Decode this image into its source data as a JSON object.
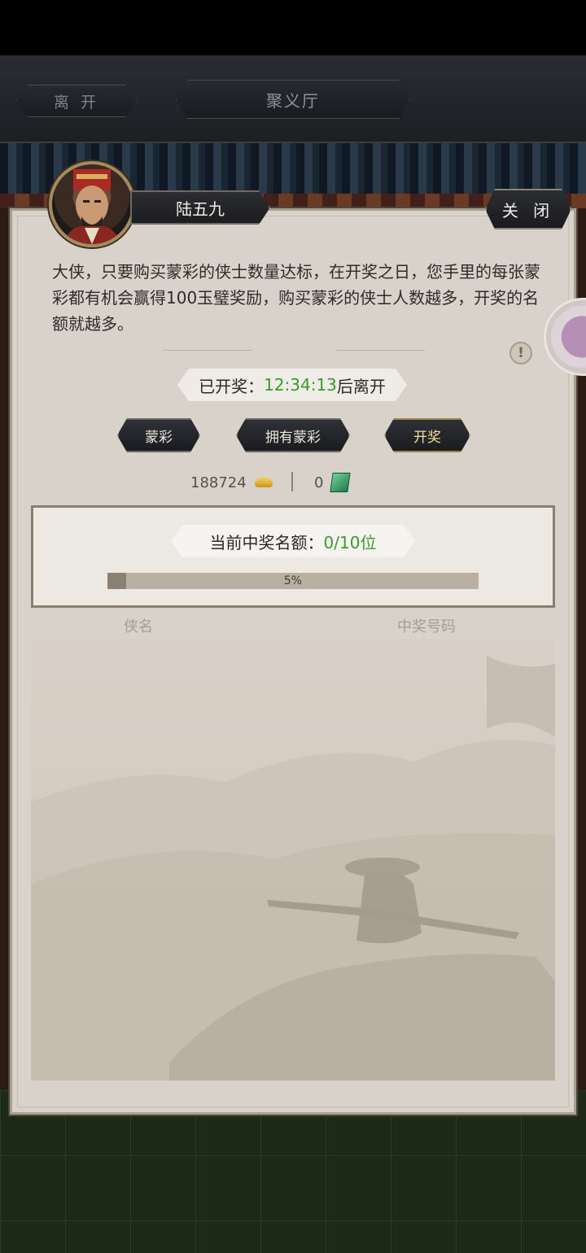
{
  "top_nav": {
    "leave_label": "离 开",
    "hall_title": "聚义厅"
  },
  "dialog": {
    "npc_name": "陆五九",
    "close_label": "关 闭",
    "description": "大侠，只要购买蒙彩的侠士数量达标，在开奖之日，您手里的每张蒙彩都有机会赢得100玉璧奖励，购买蒙彩的侠士人数越多，开奖的名额就越多。",
    "status_prefix": "已开奖：",
    "status_time": "12:34:13",
    "status_suffix": "后离开"
  },
  "tabs": [
    {
      "label": "蒙彩",
      "active": false
    },
    {
      "label": "拥有蒙彩",
      "active": false
    },
    {
      "label": "开奖",
      "active": true
    }
  ],
  "currency": {
    "gold": "188724",
    "gold_icon": "gold-ingot-icon",
    "jade": "0",
    "jade_icon": "jade-icon"
  },
  "winners": {
    "label": "当前中奖名额：",
    "value": "0/10位",
    "progress_text": "5%",
    "progress_fraction": 0.05
  },
  "table": {
    "col_name": "侠名",
    "col_number": "中奖号码",
    "rows": []
  },
  "colors": {
    "accent_green": "#3a9a2e",
    "panel_bg": "#d9d2ca",
    "button_dark": "#1b1c20"
  }
}
